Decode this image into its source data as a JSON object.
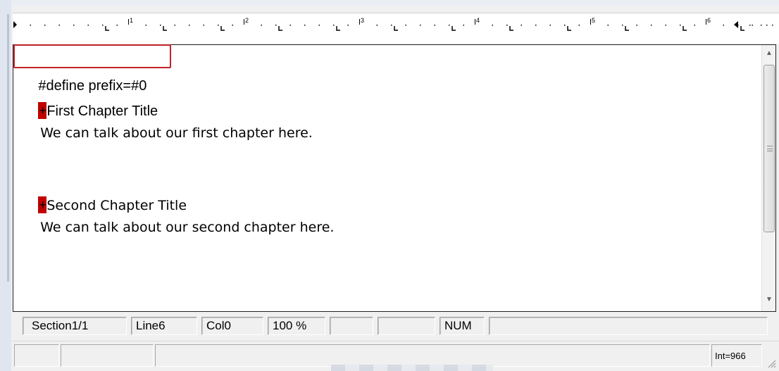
{
  "ruler": {
    "numbers": [
      "1",
      "2",
      "3",
      "4",
      "5",
      "6"
    ]
  },
  "document": {
    "define_line": "#define prefix=#0",
    "chapter1": {
      "marker_glyph": "+",
      "title": "First Chapter Title",
      "body": "We can talk about our first chapter here."
    },
    "chapter2": {
      "marker_glyph": "+",
      "title": "Second Chapter Title",
      "body": "We can talk about our second chapter here."
    }
  },
  "status": {
    "section": "Section1/1",
    "line": "Line6",
    "col": "Col0",
    "zoom": "100 %",
    "num": "NUM"
  },
  "bottom": {
    "int_label": "Int=966"
  },
  "colors": {
    "highlight_box": "#c3232a",
    "chapter_marker": "#c00000"
  },
  "icons": [
    "scroll-up-arrow-icon",
    "scroll-down-arrow-icon",
    "scroll-grip-icon",
    "left-indent-marker-icon",
    "right-indent-marker-icon",
    "resize-grip-icon"
  ]
}
